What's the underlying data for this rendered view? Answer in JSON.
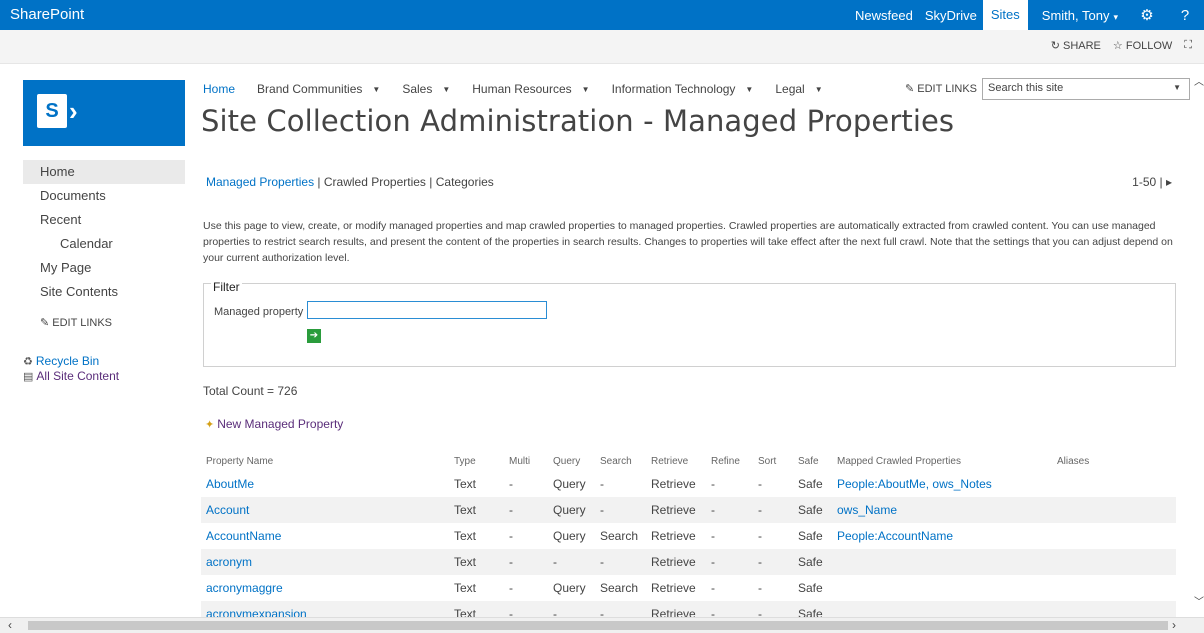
{
  "suite": {
    "brand": "SharePoint",
    "links": [
      "Newsfeed",
      "SkyDrive",
      "Sites"
    ],
    "user": "Smith, Tony",
    "gear_icon": "gear-icon",
    "help": "?"
  },
  "ribbon": {
    "share": "SHARE",
    "follow": "FOLLOW"
  },
  "topnav": {
    "items": [
      "Home",
      "Brand Communities",
      "Sales",
      "Human Resources",
      "Information Technology",
      "Legal"
    ],
    "edit_links": "EDIT LINKS",
    "search_placeholder": "Search this site"
  },
  "page_title": "Site Collection Administration - Managed Properties",
  "leftnav": {
    "items": [
      "Home",
      "Documents",
      "Recent",
      "Calendar",
      "My Page",
      "Site Contents"
    ],
    "edit_links": "EDIT LINKS",
    "recycle_bin": "Recycle Bin",
    "all_site_content": "All Site Content"
  },
  "tabs": {
    "managed": "Managed Properties",
    "crawled": "Crawled Properties",
    "categories": "Categories",
    "sep": "|"
  },
  "pager": "1-50 |",
  "description": "Use this page to view, create, or modify managed properties and map crawled properties to managed properties. Crawled properties are automatically extracted from crawled content. You can use managed properties to restrict search results, and present the content of the properties in search results. Changes to properties will take effect after the next full crawl. Note that the settings that you can adjust depend on your current authorization level.",
  "filter": {
    "legend": "Filter",
    "label": "Managed property",
    "value": ""
  },
  "total_count": "Total Count = 726",
  "new_managed_property": "New Managed Property",
  "table": {
    "columns": [
      "Property Name",
      "Type",
      "Multi",
      "Query",
      "Search",
      "Retrieve",
      "Refine",
      "Sort",
      "Safe",
      "Mapped Crawled Properties",
      "Aliases"
    ],
    "rows": [
      [
        "AboutMe",
        "Text",
        "-",
        "Query",
        "-",
        "Retrieve",
        "-",
        "-",
        "Safe",
        "People:AboutMe, ows_Notes",
        ""
      ],
      [
        "Account",
        "Text",
        "-",
        "Query",
        "-",
        "Retrieve",
        "-",
        "-",
        "Safe",
        "ows_Name",
        ""
      ],
      [
        "AccountName",
        "Text",
        "-",
        "Query",
        "Search",
        "Retrieve",
        "-",
        "-",
        "Safe",
        "People:AccountName",
        ""
      ],
      [
        "acronym",
        "Text",
        "-",
        "-",
        "-",
        "Retrieve",
        "-",
        "-",
        "Safe",
        "",
        ""
      ],
      [
        "acronymaggre",
        "Text",
        "-",
        "Query",
        "Search",
        "Retrieve",
        "-",
        "-",
        "Safe",
        "",
        ""
      ],
      [
        "acronymexpansion",
        "Text",
        "-",
        "-",
        "-",
        "Retrieve",
        "-",
        "-",
        "Safe",
        "",
        ""
      ]
    ]
  }
}
